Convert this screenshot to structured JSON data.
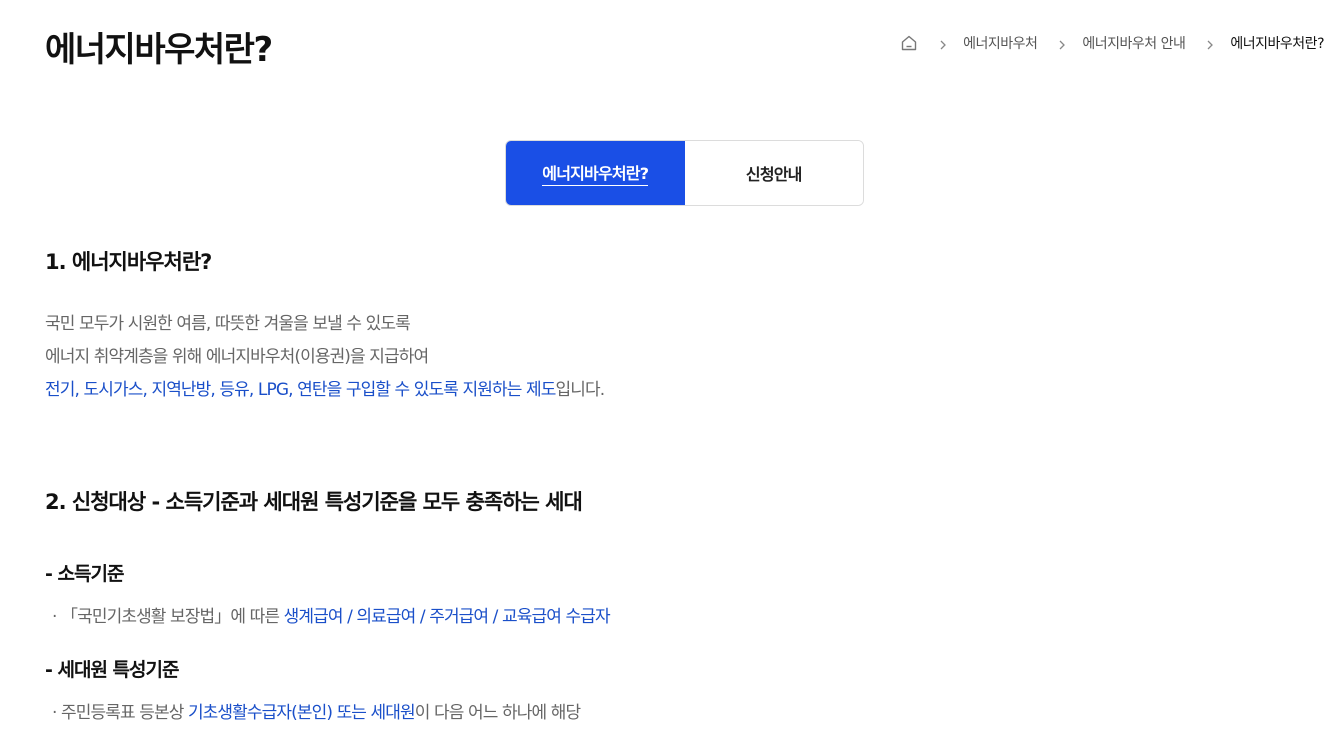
{
  "page": {
    "title": "에너지바우처란?"
  },
  "breadcrumb": {
    "home_icon": "home-icon",
    "separator_icon": "chevron-right-icon",
    "items": [
      "에너지바우처",
      "에너지바우처 안내",
      "에너지바우처란?"
    ]
  },
  "tabs": [
    {
      "label": "에너지바우처란?",
      "active": true
    },
    {
      "label": "신청안내",
      "active": false
    }
  ],
  "colors": {
    "accent": "#1a4fe6",
    "highlight_text": "#1a4fc9",
    "body_text": "#666666"
  },
  "section1": {
    "heading": "1. 에너지바우처란?",
    "line1": "국민 모두가 시원한 여름, 따뜻한 겨울을 보낼 수 있도록",
    "line2": "에너지 취약계층을 위해 에너지바우처(이용권)을 지급하여",
    "line3_highlight": "전기, 도시가스, 지역난방, 등유, LPG, 연탄을 구입할 수 있도록 지원하는 제도",
    "line3_rest": "입니다."
  },
  "section2": {
    "heading": "2. 신청대상 - 소득기준과 세대원 특성기준을 모두 충족하는 세대",
    "income": {
      "title": "- 소득기준",
      "prefix": "· 「국민기초생활 보장법」에 따른 ",
      "highlight": "생계급여 / 의료급여 / 주거급여 / 교육급여 수급자"
    },
    "household": {
      "title": "- 세대원 특성기준",
      "prefix": "· 주민등록표 등본상 ",
      "highlight": "기초생활수급자(본인) 또는 세대원",
      "suffix": "이 다음 어느 하나에 해당"
    }
  }
}
